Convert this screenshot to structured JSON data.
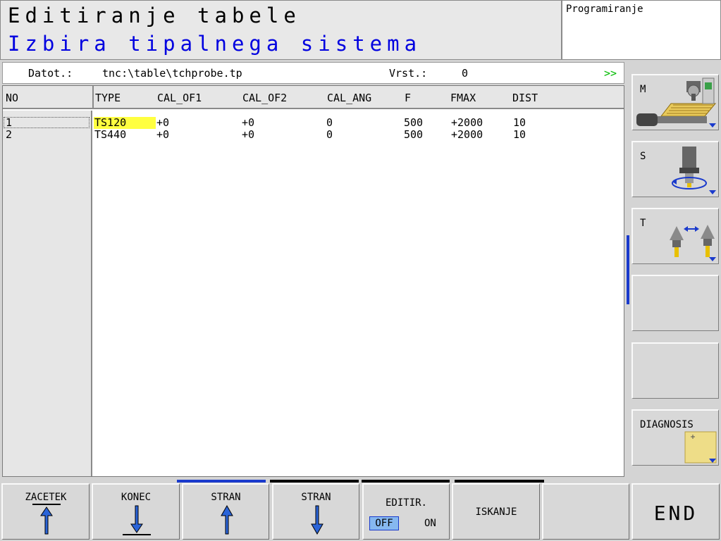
{
  "header": {
    "title_line1": "Editiranje tabele",
    "title_line2": "Izbira tipalnega sistema",
    "mode": "Programiranje"
  },
  "file_info": {
    "file_label": "Datot.:",
    "file_path": "tnc:\\table\\tchprobe.tp",
    "row_label": "Vrst.:",
    "row_value": "0",
    "more": ">>"
  },
  "table": {
    "columns": [
      "NO",
      "TYPE",
      "CAL_OF1",
      "CAL_OF2",
      "CAL_ANG",
      "F",
      "FMAX",
      "DIST"
    ],
    "rows": [
      {
        "NO": "1",
        "TYPE": "TS120",
        "CAL_OF1": "+0",
        "CAL_OF2": "+0",
        "CAL_ANG": "0",
        "F": "500",
        "FMAX": "+2000",
        "DIST": "10"
      },
      {
        "NO": "2",
        "TYPE": "TS440",
        "CAL_OF1": "+0",
        "CAL_OF2": "+0",
        "CAL_ANG": "0",
        "F": "500",
        "FMAX": "+2000",
        "DIST": "10"
      }
    ]
  },
  "side_softkeys": [
    {
      "label": "M",
      "icon": "machine-table-icon"
    },
    {
      "label": "S",
      "icon": "spindle-orientation-icon"
    },
    {
      "label": "T",
      "icon": "tool-probe-icon"
    },
    {
      "label": ""
    },
    {
      "label": ""
    },
    {
      "label": "DIAGNOSIS",
      "icon": "diagnosis-icon"
    }
  ],
  "bottom_softkeys": {
    "begin": "ZACETEK",
    "end_of_table": "KONEC",
    "page_up": "STRAN",
    "page_down": "STRAN",
    "edit": "EDITIR.",
    "edit_off": "OFF",
    "edit_on": "ON",
    "search": "ISKANJE",
    "end": "END"
  },
  "colors": {
    "highlight": "#ffff40",
    "accent_blue": "#1a3acc",
    "title_blue": "#0000e0",
    "more_green": "#00bb00"
  }
}
